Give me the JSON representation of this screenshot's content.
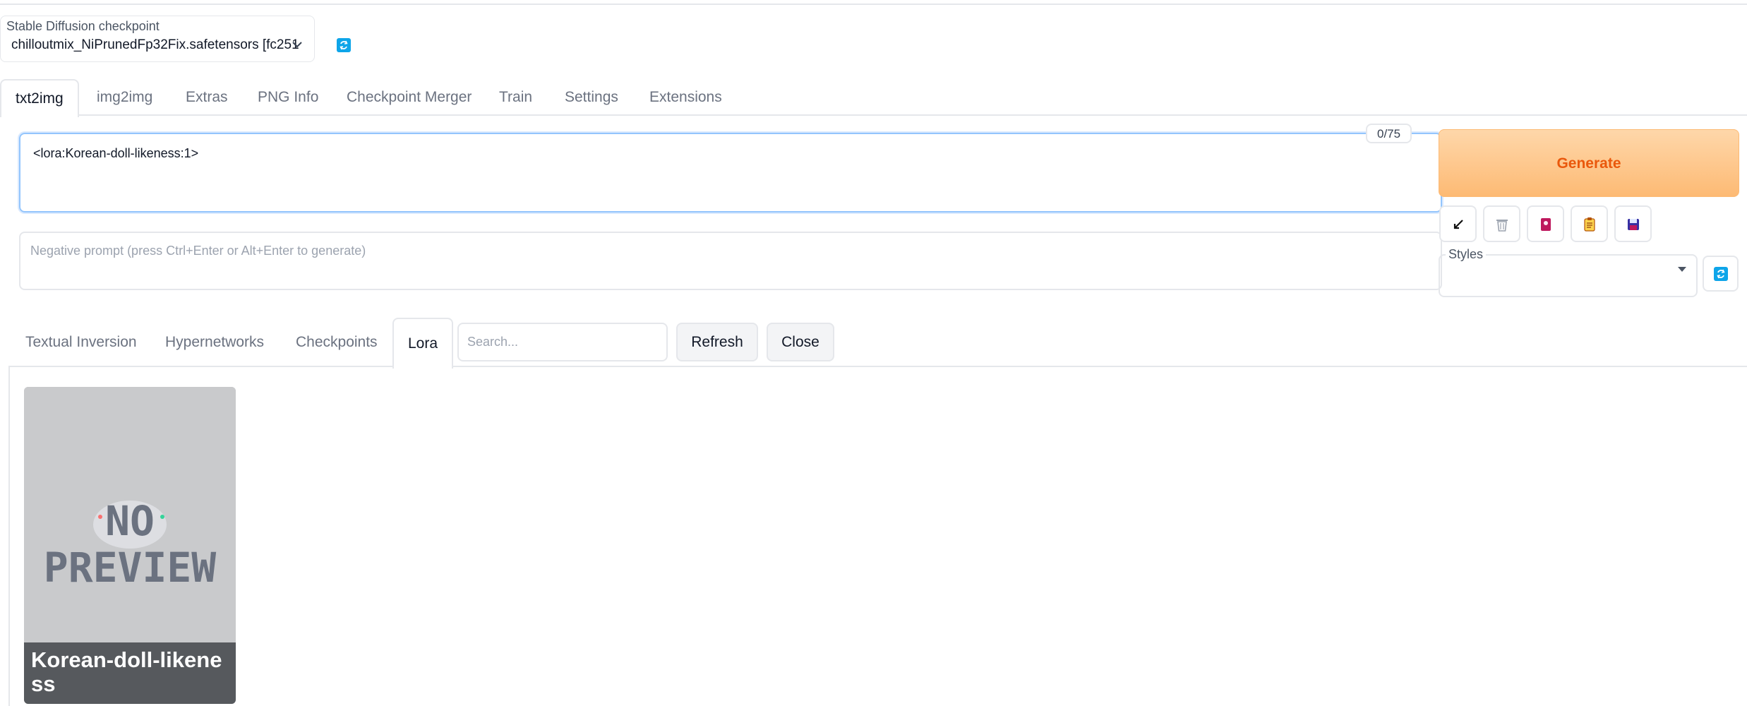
{
  "checkpoint": {
    "label": "Stable Diffusion checkpoint",
    "value": "chilloutmix_NiPrunedFp32Fix.safetensors [fc251"
  },
  "main_tabs": [
    {
      "label": "txt2img",
      "active": true
    },
    {
      "label": "img2img"
    },
    {
      "label": "Extras"
    },
    {
      "label": "PNG Info"
    },
    {
      "label": "Checkpoint Merger"
    },
    {
      "label": "Train"
    },
    {
      "label": "Settings"
    },
    {
      "label": "Extensions"
    }
  ],
  "prompt": {
    "value": "<lora:Korean-doll-likeness:1>",
    "counter": "0/75"
  },
  "negative_prompt": {
    "placeholder": "Negative prompt (press Ctrl+Enter or Alt+Enter to generate)"
  },
  "generate_label": "Generate",
  "tool_buttons": [
    "arrow-icon",
    "trash-icon",
    "bookmark-icon",
    "clipboard-icon",
    "save-icon"
  ],
  "styles": {
    "label": "Styles",
    "value": ""
  },
  "extra_tabs": [
    {
      "label": "Textual Inversion"
    },
    {
      "label": "Hypernetworks"
    },
    {
      "label": "Checkpoints"
    },
    {
      "label": "Lora",
      "active": true
    }
  ],
  "search": {
    "placeholder": "Search..."
  },
  "refresh_label": "Refresh",
  "close_label": "Close",
  "cards": [
    {
      "name": "Korean-doll-likeness",
      "preview_text": "NO PREVIEW"
    }
  ],
  "colors": {
    "accent_blue": "#0ea5e9",
    "generate_bg": "#fdba74",
    "generate_text": "#ea580c"
  }
}
